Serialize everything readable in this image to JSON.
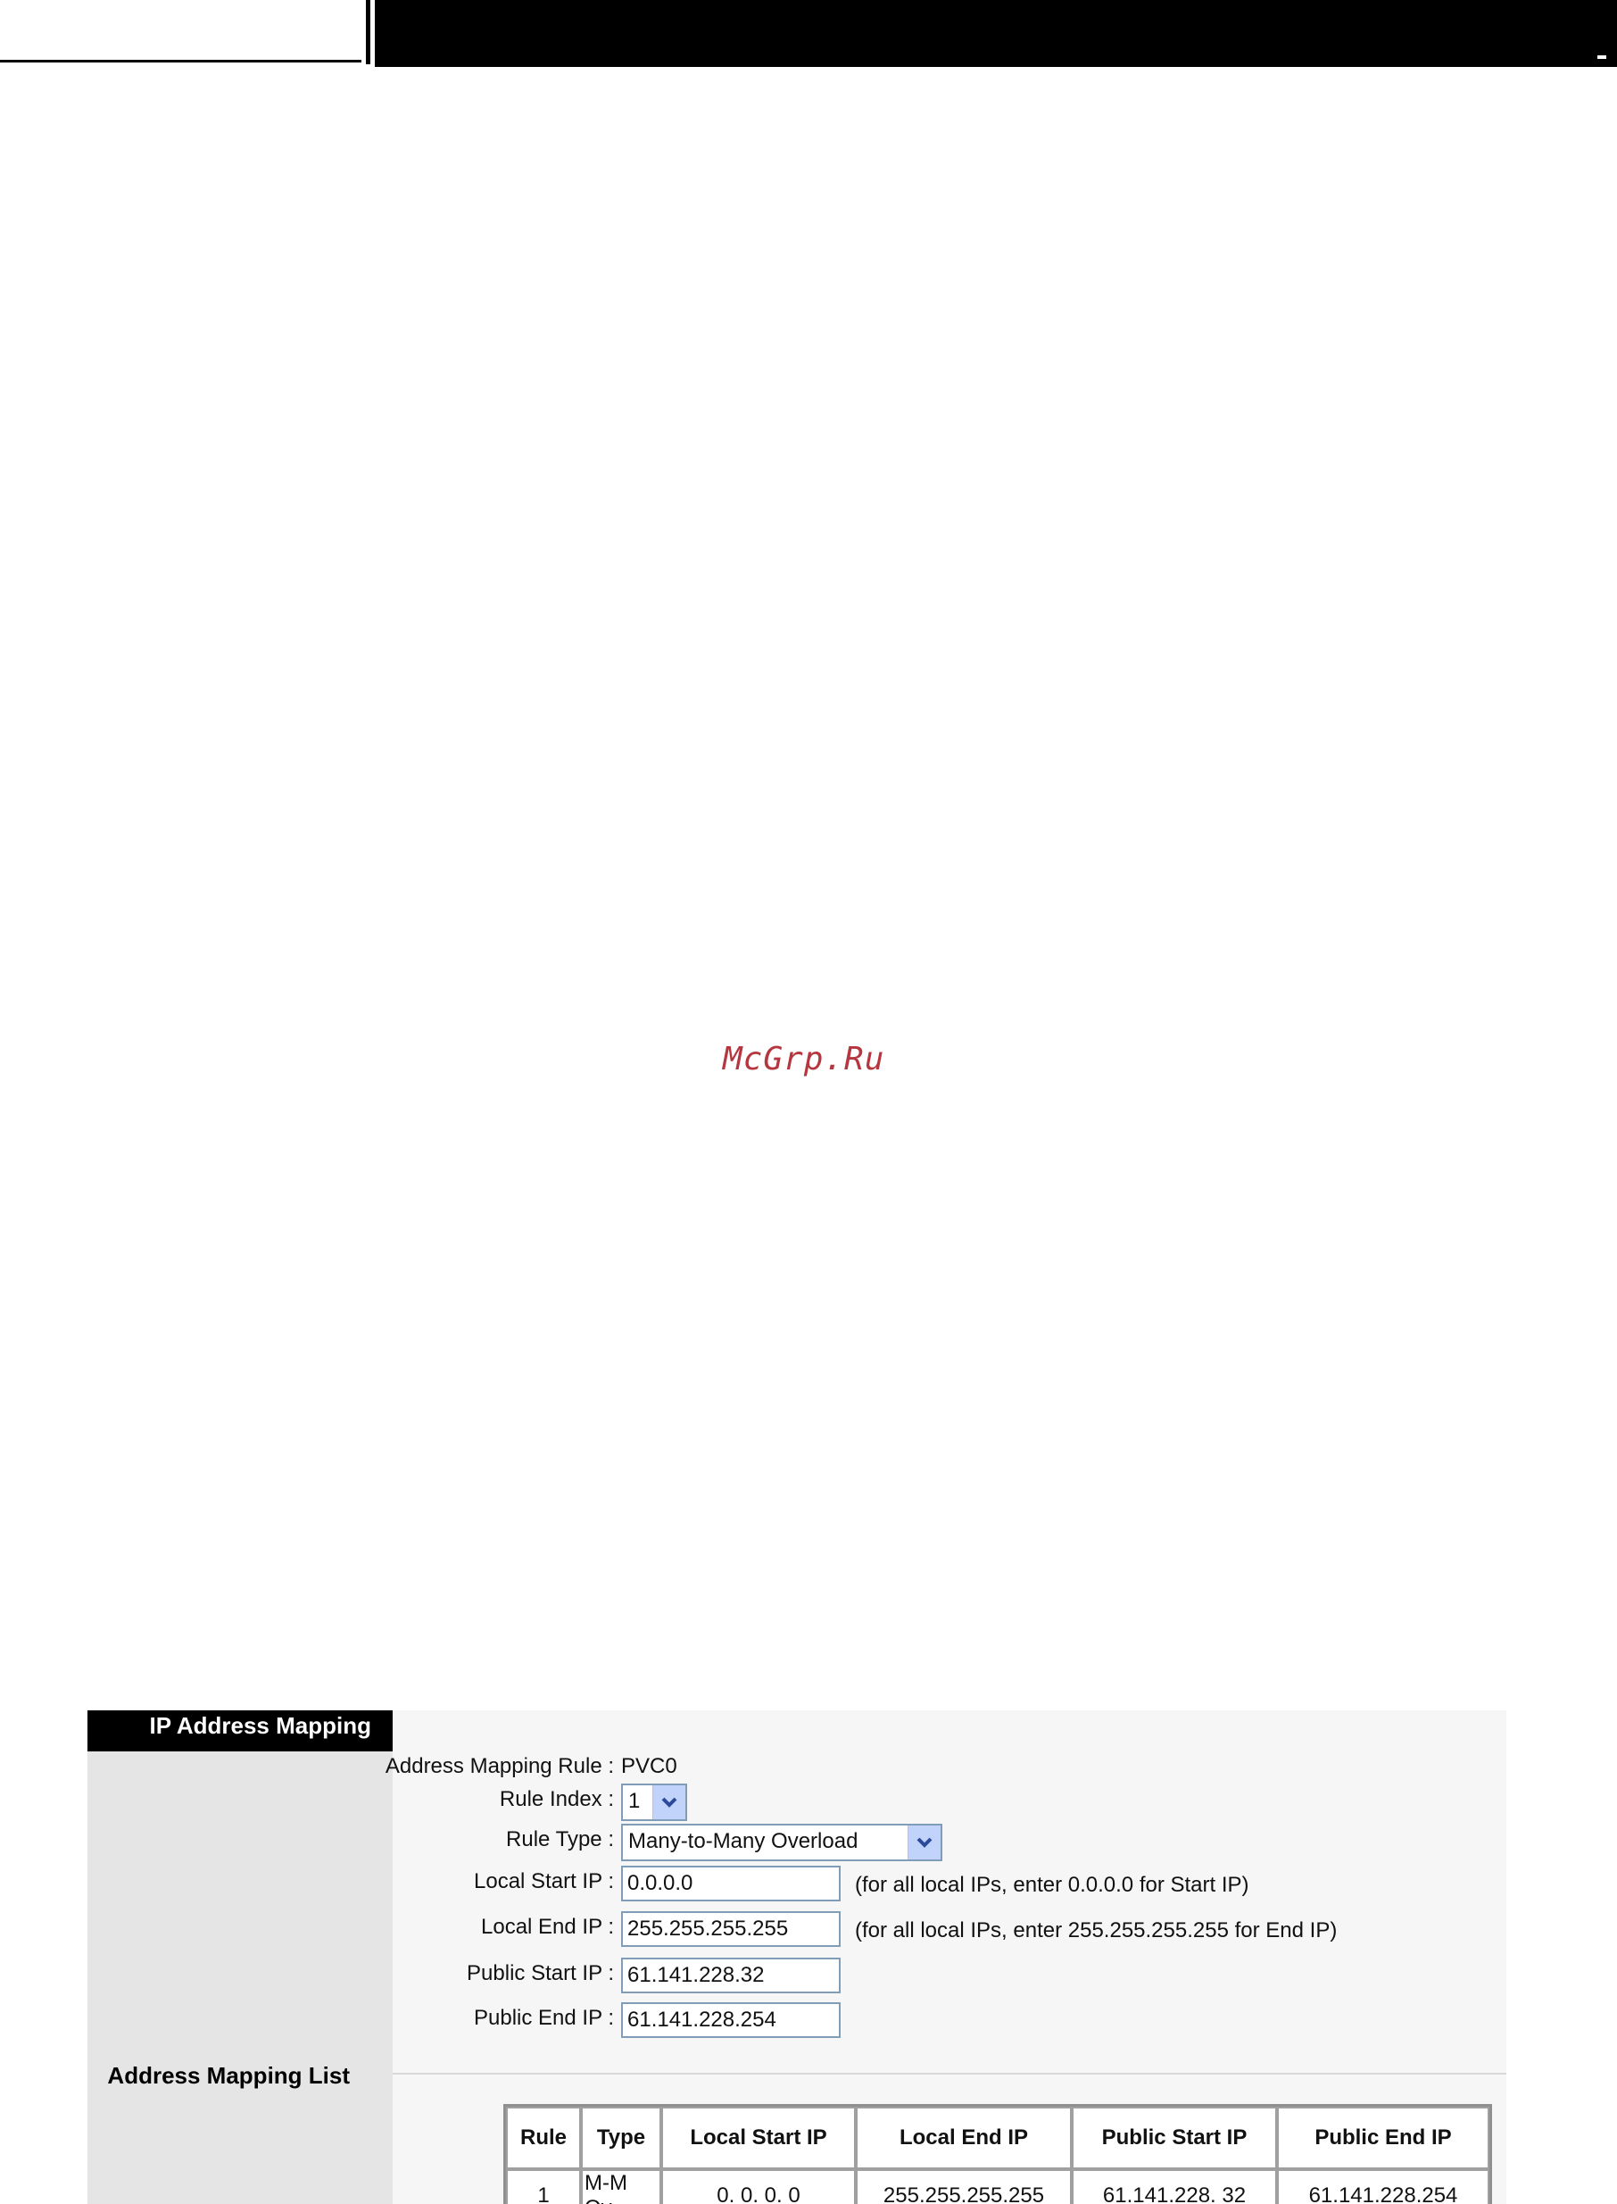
{
  "watermark": "McGrp.Ru",
  "section": {
    "title": "IP Address Mapping",
    "list_title": "Address Mapping List"
  },
  "form": {
    "mapping_rule": {
      "label": "Address Mapping Rule :",
      "value": "PVC0"
    },
    "rule_index": {
      "label": "Rule Index :",
      "value": "1"
    },
    "rule_type": {
      "label": "Rule Type :",
      "value": "Many-to-Many Overload"
    },
    "local_start_ip": {
      "label": "Local Start IP :",
      "value": "0.0.0.0",
      "hint": "(for all local IPs, enter 0.0.0.0 for Start IP)"
    },
    "local_end_ip": {
      "label": "Local End IP :",
      "value": "255.255.255.255",
      "hint": "(for all local IPs, enter 255.255.255.255 for End IP)"
    },
    "public_start_ip": {
      "label": "Public Start IP :",
      "value": "61.141.228.32"
    },
    "public_end_ip": {
      "label": "Public End IP :",
      "value": "61.141.228.254"
    }
  },
  "table": {
    "headers": [
      "Rule",
      "Type",
      "Local Start IP",
      "Local End IP",
      "Public Start IP",
      "Public End IP"
    ],
    "rows": [
      [
        "1",
        "M-M Ov",
        "0. 0. 0. 0",
        "255.255.255.255",
        "61.141.228. 32",
        "61.141.228.254"
      ]
    ]
  },
  "icons": {
    "dropdown": "chevron-down-icon"
  },
  "colors": {
    "header_bar": "#000000",
    "left_column": "#e5e5e5",
    "panel": "#f6f6f6",
    "input_border": "#7f9db9",
    "dropdown_button": "#c1d3fb",
    "watermark": "#b5363f"
  }
}
